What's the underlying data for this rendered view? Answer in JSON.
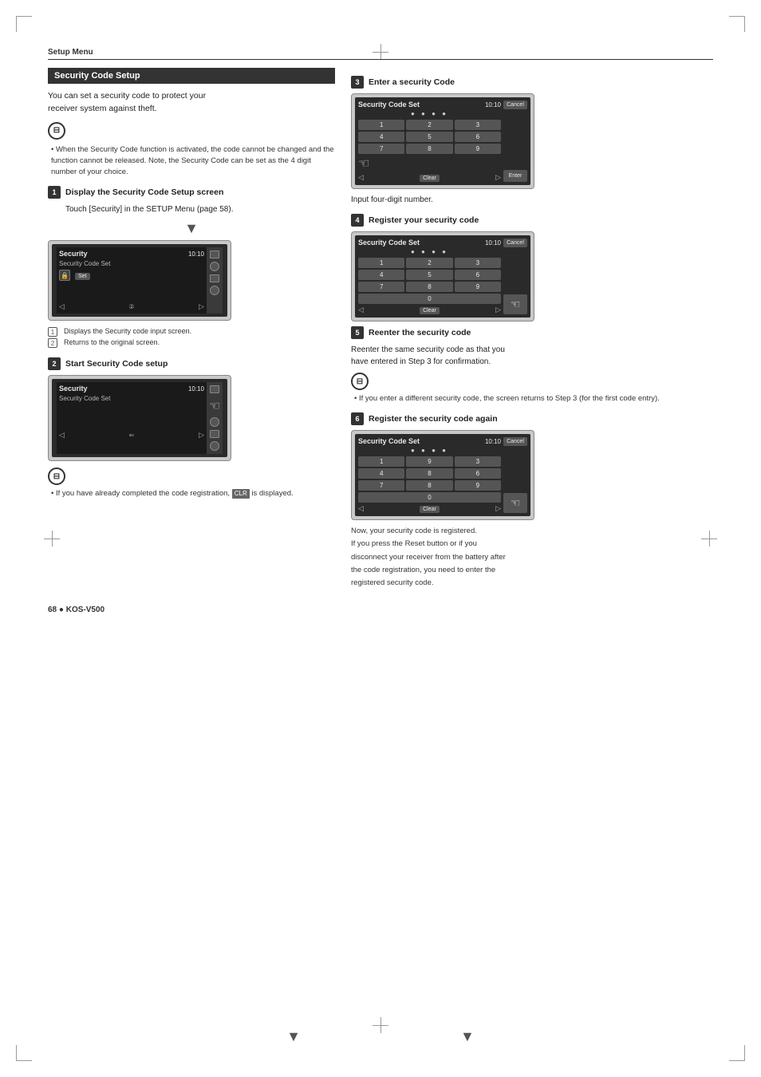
{
  "page": {
    "title": "Setup Menu",
    "page_number": "68 ● KOS-V500",
    "section_title": "Security Code Setup",
    "intro": {
      "line1": "You can set a security code to protect your",
      "line2": "receiver system against theft."
    },
    "note1": {
      "bullet": "When the Security Code function is activated, the code cannot be changed and the function cannot be released. Note, the Security Code can be set as the 4 digit number of your choice."
    },
    "steps": [
      {
        "num": "1",
        "title": "Display the Security Code Setup screen",
        "desc": "Touch [Security] in the SETUP Menu (page 58).",
        "annotations": [
          "Displays the Security code input screen.",
          "Returns to the original screen."
        ]
      },
      {
        "num": "2",
        "title": "Start Security Code setup",
        "note": "If you have already completed the code registration,",
        "clr_label": "CLR",
        "clr_suffix": "is displayed."
      },
      {
        "num": "3",
        "title": "Enter a security Code",
        "desc": "Input four-digit number."
      },
      {
        "num": "4",
        "title": "Register your security code"
      },
      {
        "num": "5",
        "title": "Reenter the security code",
        "desc1": "Reenter the same security code as that you",
        "desc2": "have entered in Step 3 for confirmation.",
        "note": "If you enter a different security code, the screen returns to Step 3 (for the first code entry)."
      },
      {
        "num": "6",
        "title": "Register the security code again",
        "final_note1": "Now, your security code is registered.",
        "final_note2": "If you press the Reset button or if you",
        "final_note3": "disconnect your receiver from the battery after",
        "final_note4": "the code registration, you need to enter the",
        "final_note5": "registered security code."
      }
    ],
    "screen": {
      "title": "Security",
      "subtitle": "Security Code Set",
      "time": "10:10",
      "set_btn": "Set",
      "cancel_btn": "Cancel",
      "enter_btn": "Enter",
      "clear_btn": "Clear",
      "numpad_keys": [
        "1",
        "2",
        "3",
        "4",
        "5",
        "6",
        "7",
        "8",
        "9"
      ],
      "numpad_0": "0",
      "dots": "● ● ● ●"
    }
  }
}
